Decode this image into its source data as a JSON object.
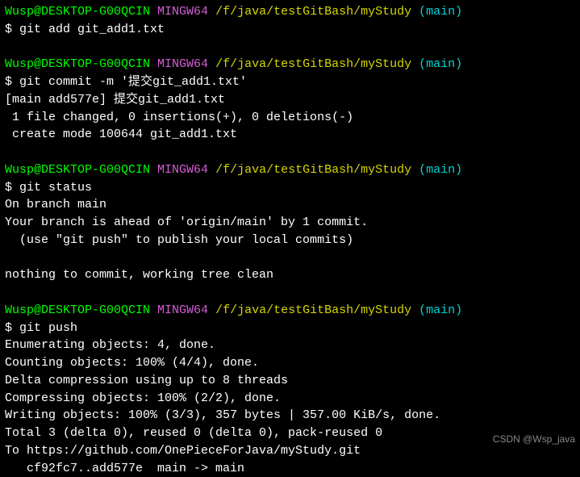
{
  "prompt": {
    "user_host": "Wusp@DESKTOP-G00QCIN",
    "mingw": "MINGW64",
    "path": "/f/java/testGitBash/myStudy",
    "branch": "(main)",
    "dollar": "$ "
  },
  "block1": {
    "cmd": "git add git_add1.txt"
  },
  "block2": {
    "cmd": "git commit -m '提交git_add1.txt'",
    "out1": "[main add577e] 提交git_add1.txt",
    "out2": " 1 file changed, 0 insertions(+), 0 deletions(-)",
    "out3": " create mode 100644 git_add1.txt"
  },
  "block3": {
    "cmd": "git status",
    "out1": "On branch main",
    "out2": "Your branch is ahead of 'origin/main' by 1 commit.",
    "out3": "  (use \"git push\" to publish your local commits)",
    "out4": "nothing to commit, working tree clean"
  },
  "block4": {
    "cmd": "git push",
    "out1": "Enumerating objects: 4, done.",
    "out2": "Counting objects: 100% (4/4), done.",
    "out3": "Delta compression using up to 8 threads",
    "out4": "Compressing objects: 100% (2/2), done.",
    "out5": "Writing objects: 100% (3/3), 357 bytes | 357.00 KiB/s, done.",
    "out6": "Total 3 (delta 0), reused 0 (delta 0), pack-reused 0",
    "out7": "To https://github.com/OnePieceForJava/myStudy.git",
    "out8": "   cf92fc7..add577e  main -> main"
  },
  "watermark": "CSDN @Wsp_java"
}
